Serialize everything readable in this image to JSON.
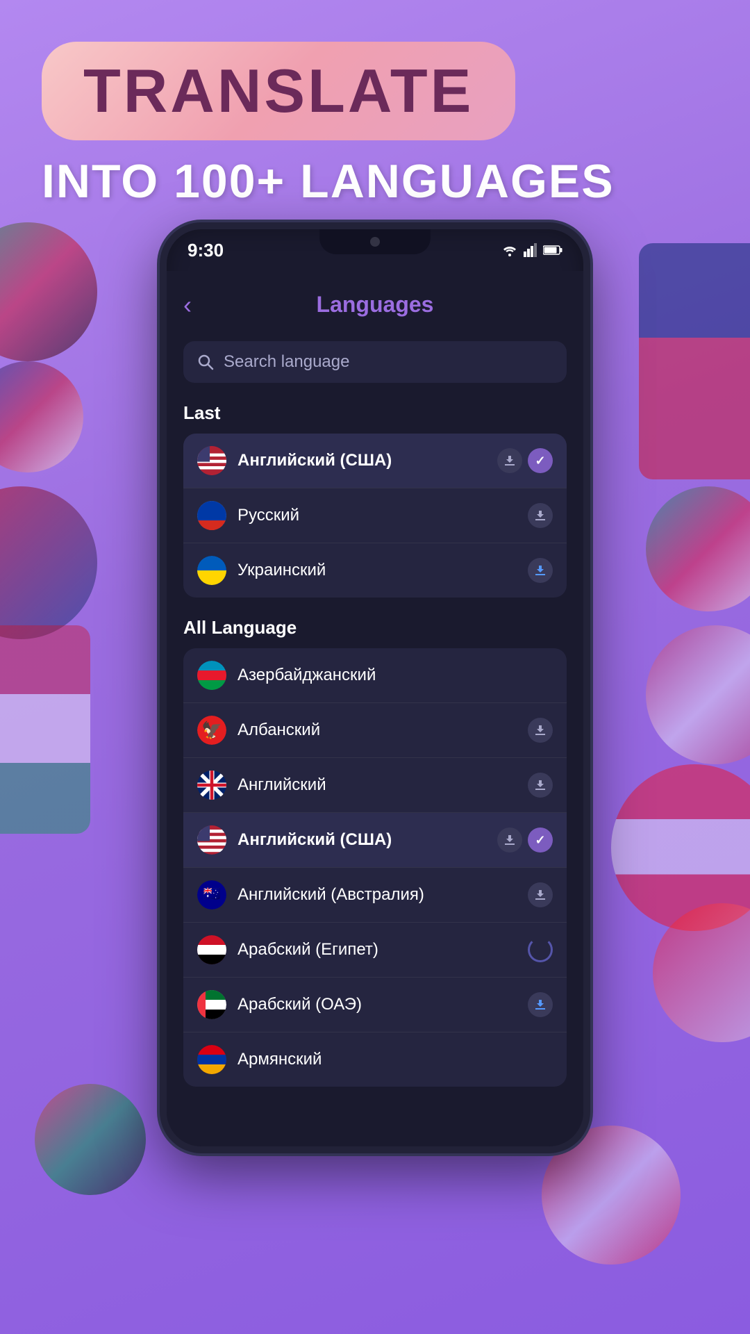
{
  "background": {
    "gradient_start": "#b388f0",
    "gradient_end": "#8b5ce0"
  },
  "top_section": {
    "badge_text": "TRANSLATE",
    "subtitle": "INTO 100+ LANGUAGES"
  },
  "status_bar": {
    "time": "9:30",
    "wifi_icon": "wifi",
    "signal_icon": "signal",
    "battery_icon": "battery"
  },
  "header": {
    "back_label": "‹",
    "title": "Languages"
  },
  "search": {
    "placeholder": "Search language"
  },
  "last_section": {
    "label": "Last",
    "items": [
      {
        "name": "Английский (США)",
        "flag": "us",
        "bold": true,
        "selected": true,
        "has_download": true,
        "has_check": true
      },
      {
        "name": "Русский",
        "flag": "ru",
        "bold": false,
        "selected": false,
        "has_download": true,
        "has_check": false
      },
      {
        "name": "Украинский",
        "flag": "ua",
        "bold": false,
        "selected": false,
        "has_download": true,
        "has_check": false
      }
    ]
  },
  "all_section": {
    "label": "All Language",
    "items": [
      {
        "name": "Азербайджанский",
        "flag": "az",
        "bold": false,
        "selected": false,
        "has_download": false,
        "has_check": false
      },
      {
        "name": "Албанский",
        "flag": "al",
        "bold": false,
        "selected": false,
        "has_download": true,
        "has_check": false
      },
      {
        "name": "Английский",
        "flag": "gb",
        "bold": false,
        "selected": false,
        "has_download": true,
        "has_check": false
      },
      {
        "name": "Английский (США)",
        "flag": "us",
        "bold": true,
        "selected": true,
        "has_download": true,
        "has_check": true
      },
      {
        "name": "Английский (Австралия)",
        "flag": "au",
        "bold": false,
        "selected": false,
        "has_download": true,
        "has_check": false
      },
      {
        "name": "Арабский (Египет)",
        "flag": "eg",
        "bold": false,
        "selected": false,
        "has_download": false,
        "has_check": false,
        "loading": true
      },
      {
        "name": "Арабский (ОАЭ)",
        "flag": "ae",
        "bold": false,
        "selected": false,
        "has_download": true,
        "has_check": false
      },
      {
        "name": "Армянский",
        "flag": "am",
        "bold": false,
        "selected": false,
        "has_download": false,
        "has_check": false
      }
    ]
  }
}
